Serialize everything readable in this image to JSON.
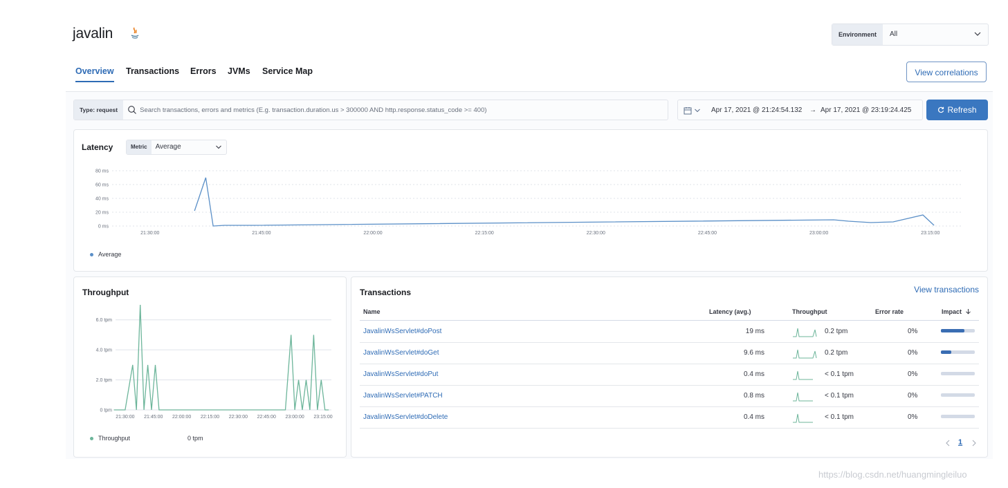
{
  "header": {
    "app_title": "javalin",
    "environment_label": "Environment",
    "environment_value": "All"
  },
  "tabs": [
    {
      "label": "Overview",
      "active": true
    },
    {
      "label": "Transactions",
      "active": false
    },
    {
      "label": "Errors",
      "active": false
    },
    {
      "label": "JVMs",
      "active": false
    },
    {
      "label": "Service Map",
      "active": false
    }
  ],
  "view_correlations_label": "View correlations",
  "search": {
    "type_label": "Type: request",
    "placeholder": "Search transactions, errors and metrics (E.g. transaction.duration.us > 300000 AND http.response.status_code >= 400)"
  },
  "date_range": {
    "start": "Apr 17, 2021 @ 21:24:54.132",
    "arrow": "→",
    "end": "Apr 17, 2021 @ 23:19:24.425"
  },
  "refresh_label": "Refresh",
  "latency": {
    "title": "Latency",
    "metric_label": "Metric",
    "metric_value": "Average",
    "legend": "Average",
    "colors": {
      "line": "#5a8fc7"
    }
  },
  "throughput": {
    "title": "Throughput",
    "legend": "Throughput",
    "legend_value": "0 tpm",
    "colors": {
      "line": "#6cb59a"
    }
  },
  "transactions": {
    "title": "Transactions",
    "view_link": "View transactions",
    "columns": [
      "Name",
      "Latency (avg.)",
      "Throughput",
      "Error rate",
      "Impact"
    ],
    "rows": [
      {
        "name": "JavalinWsServlet#doPost",
        "latency": "19 ms",
        "throughput": "0.2 tpm",
        "error_rate": "0%",
        "impact": 0.7
      },
      {
        "name": "JavalinWsServlet#doGet",
        "latency": "9.6 ms",
        "throughput": "0.2 tpm",
        "error_rate": "0%",
        "impact": 0.3
      },
      {
        "name": "JavalinWsServlet#doPut",
        "latency": "0.4 ms",
        "throughput": "< 0.1 tpm",
        "error_rate": "0%",
        "impact": 0.0
      },
      {
        "name": "JavalinWsServlet#PATCH",
        "latency": "0.8 ms",
        "throughput": "< 0.1 tpm",
        "error_rate": "0%",
        "impact": 0.0
      },
      {
        "name": "JavalinWsServlet#doDelete",
        "latency": "0.4 ms",
        "throughput": "< 0.1 tpm",
        "error_rate": "0%",
        "impact": 0.0
      }
    ],
    "pagination_page": "1"
  },
  "chart_data": [
    {
      "type": "line",
      "ylim": [
        0,
        80
      ],
      "yticks": [
        "0 ms",
        "20 ms",
        "40 ms",
        "60 ms",
        "80 ms"
      ],
      "xticks": [
        "21:30:00",
        "21:45:00",
        "22:00:00",
        "22:15:00",
        "22:30:00",
        "22:45:00",
        "23:00:00",
        "23:15:00"
      ],
      "series": [
        {
          "name": "Average",
          "x": [
            "21:36:00",
            "21:37:30",
            "21:38:30",
            "21:40:00",
            "21:42:00",
            "21:44:00",
            "23:02:00",
            "23:04:00",
            "23:07:00",
            "23:10:00",
            "23:14:00",
            "23:15:30"
          ],
          "y": [
            22,
            70,
            0,
            1,
            1,
            1,
            9,
            7,
            5,
            6,
            16,
            1
          ]
        }
      ],
      "grid": true,
      "legend_placement": "bottom-left"
    },
    {
      "type": "line",
      "ylim": [
        0,
        7
      ],
      "yticks": [
        "0 tpm",
        "2.0 tpm",
        "4.0 tpm",
        "6.0 tpm"
      ],
      "xticks": [
        "21:30:00",
        "21:45:00",
        "22:00:00",
        "22:15:00",
        "22:30:00",
        "22:45:00",
        "23:00:00",
        "23:15:00"
      ],
      "series": [
        {
          "name": "Throughput",
          "x": [
            "21:24:00",
            "21:30:00",
            "21:34:00",
            "21:36:00",
            "21:38:00",
            "21:40:00",
            "21:42:00",
            "21:44:00",
            "21:46:00",
            "21:48:00",
            "21:52:00",
            "22:30:00",
            "22:55:00",
            "22:58:00",
            "23:00:00",
            "23:02:00",
            "23:04:00",
            "23:06:00",
            "23:08:00",
            "23:10:00",
            "23:12:00",
            "23:14:00",
            "23:16:00",
            "23:18:00"
          ],
          "y": [
            0,
            0,
            3,
            0,
            7,
            0,
            3,
            0,
            3,
            0,
            0,
            0,
            0,
            5,
            0,
            2,
            0,
            2,
            0,
            5,
            0,
            2,
            0,
            0
          ]
        }
      ],
      "grid": true,
      "legend_placement": "bottom-left"
    }
  ],
  "watermark": "https://blog.csdn.net/huangmingleiluo"
}
